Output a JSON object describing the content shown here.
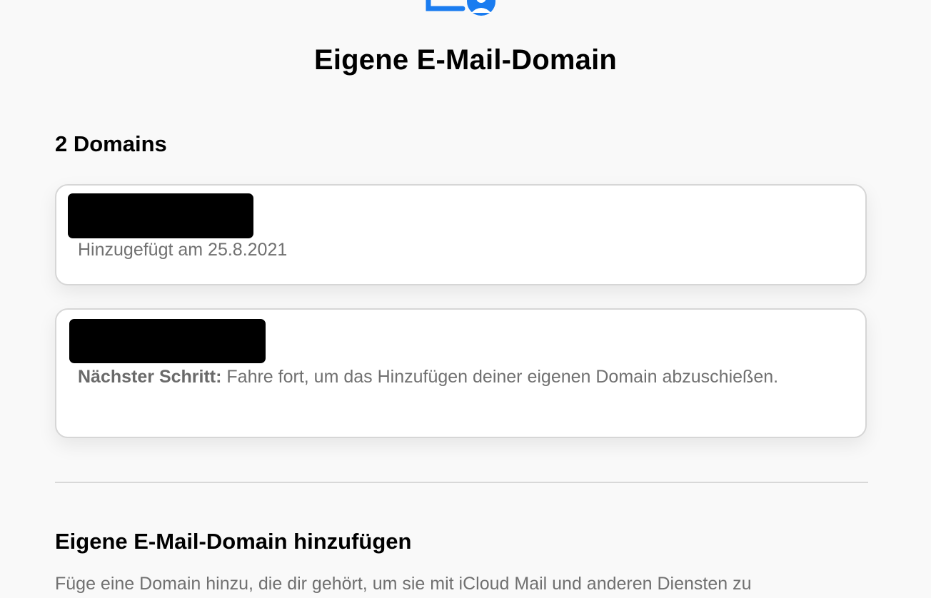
{
  "header": {
    "icon": "mail-person-icon",
    "title": "Eigene E-Mail-Domain"
  },
  "domains": {
    "heading": "2 Domains",
    "cards": [
      {
        "name_redacted": true,
        "meta": "Hinzugefügt am 25.8.2021"
      },
      {
        "name_redacted": true,
        "note_label": "Nächster Schritt:",
        "note_text": " Fahre fort, um das Hinzufügen deiner eigenen Domain abzuschießen."
      }
    ]
  },
  "add_section": {
    "heading": "Eigene E-Mail-Domain hinzufügen",
    "description": "Füge eine Domain hinzu, die dir gehört, um sie mit iCloud Mail und anderen Diensten zu"
  },
  "colors": {
    "accent": "#1a7cf0",
    "background": "#f9f9f9",
    "secondary_text": "#707070"
  }
}
